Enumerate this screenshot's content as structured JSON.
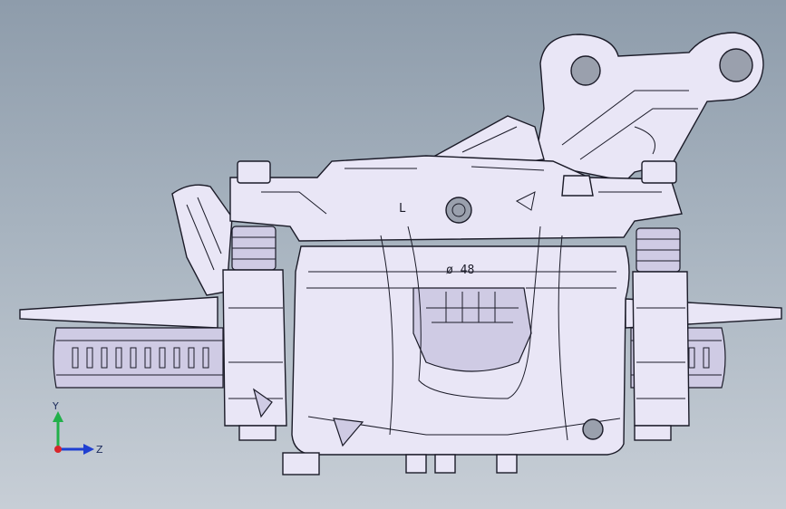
{
  "viewport": {
    "background_top": "#8e9cab",
    "background_bottom": "#c7ced6"
  },
  "model": {
    "engraving_side": "L",
    "engraving_diameter": "ø 48"
  },
  "triad": {
    "y_label": "Y",
    "z_label": "Z",
    "y_color": "#22b04a",
    "z_color": "#1f3fd1",
    "x_color": "#d8262b"
  }
}
